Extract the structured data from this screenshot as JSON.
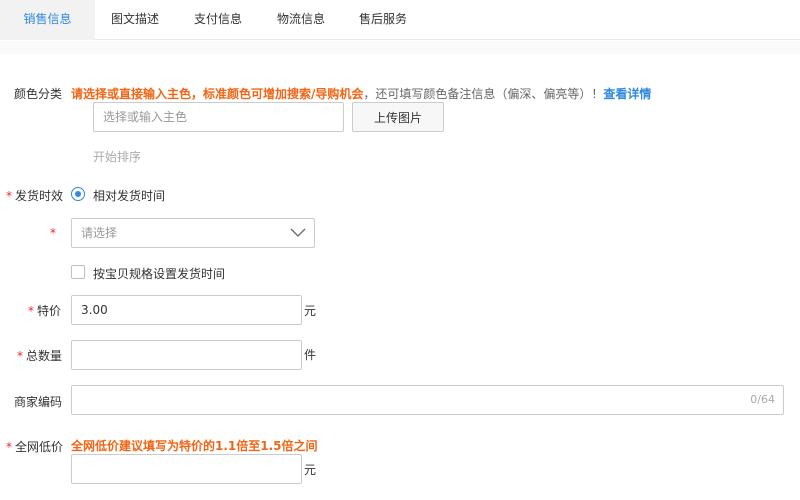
{
  "tabs": [
    {
      "label": "销售信息",
      "active": true
    },
    {
      "label": "图文描述",
      "active": false
    },
    {
      "label": "支付信息",
      "active": false
    },
    {
      "label": "物流信息",
      "active": false
    },
    {
      "label": "售后服务",
      "active": false
    }
  ],
  "color_category": {
    "label": "颜色分类",
    "hint_orange": "请选择或直接输入主色，标准颜色可增加搜索/导购机会",
    "hint_gray": "，还可填写颜色备注信息（偏深、偏亮等）！",
    "hint_link": "查看详情",
    "input_placeholder": "选择或输入主色",
    "upload_button": "上传图片",
    "sort_link": "开始排序"
  },
  "shipping_time": {
    "label": "发货时效",
    "required_mark": "*",
    "radio_label": "相对发货时间",
    "select_placeholder": "请选择",
    "checkbox_label": "按宝贝规格设置发货时间"
  },
  "special_price": {
    "label": "特价",
    "required_mark": "*",
    "value": "3.00",
    "unit": "元"
  },
  "total_quantity": {
    "label": "总数量",
    "required_mark": "*",
    "value": "",
    "unit": "件"
  },
  "merchant_code": {
    "label": "商家编码",
    "value": "",
    "counter": "0/64"
  },
  "lowest_price": {
    "label": "全网低价",
    "required_mark": "*",
    "hint": "全网低价建议填写为特价的1.1倍至1.5倍之间",
    "value": "",
    "unit": "元"
  },
  "colors": {
    "accent": "#3089dc",
    "warning": "#f06617",
    "required": "#f5222d"
  }
}
